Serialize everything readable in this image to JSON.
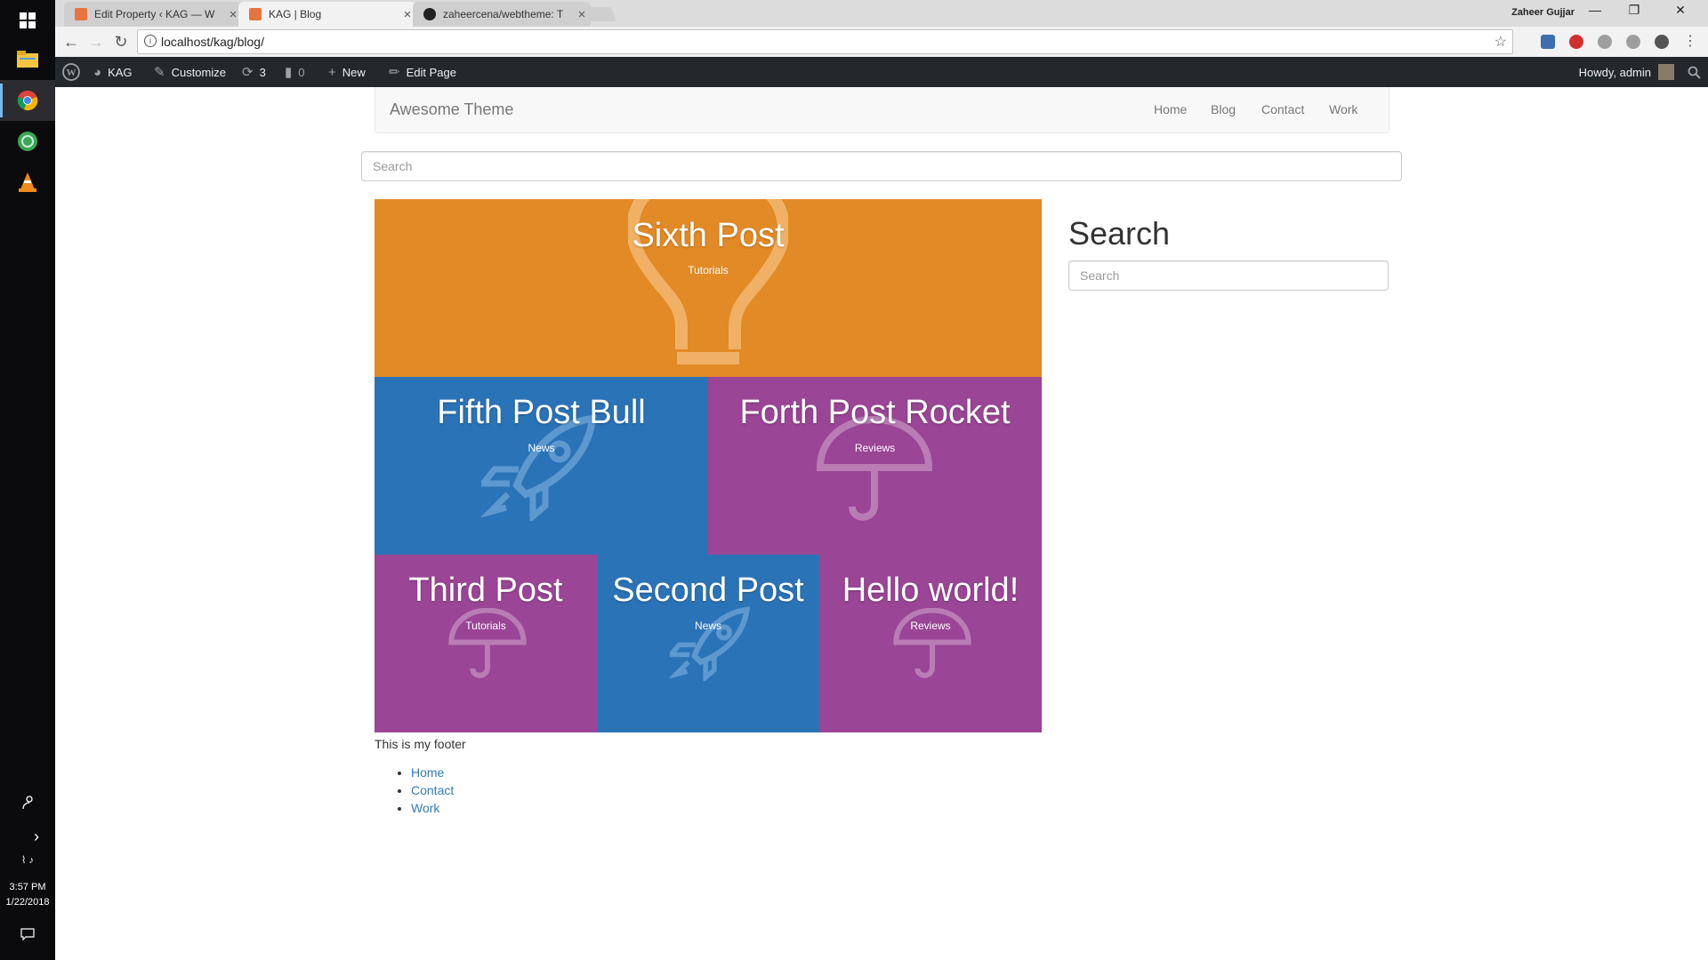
{
  "os": {
    "clock_time": "3:57 PM",
    "clock_date": "1/22/2018"
  },
  "browser": {
    "tabs": [
      {
        "label": "Edit Property ‹ KAG — W",
        "active": false
      },
      {
        "label": "KAG | Blog",
        "active": true
      },
      {
        "label": "zaheercena/webtheme: T",
        "active": false
      }
    ],
    "profile_name": "Zaheer Gujjar",
    "url": "localhost/kag/blog/"
  },
  "adminbar": {
    "site_name": "KAG",
    "customize": "Customize",
    "updates_count": "3",
    "comments_count": "0",
    "new": "New",
    "edit_page": "Edit Page",
    "howdy": "Howdy, admin"
  },
  "site": {
    "brand": "Awesome Theme",
    "nav": [
      "Home",
      "Blog",
      "Contact",
      "Work"
    ],
    "top_search_placeholder": "Search"
  },
  "posts": [
    {
      "title": "Sixth Post",
      "category": "Tutorials",
      "color": "#e28a26",
      "icon": "lightbulb-icon"
    },
    {
      "title": "Fifth Post Bull",
      "category": "News",
      "color": "#2b73b7",
      "icon": "rocket-icon"
    },
    {
      "title": "Forth Post Rocket",
      "category": "Reviews",
      "color": "#9a4595",
      "icon": "umbrella-icon"
    },
    {
      "title": "Third Post",
      "category": "Tutorials",
      "color": "#9a4595",
      "icon": "umbrella-icon"
    },
    {
      "title": "Second Post",
      "category": "News",
      "color": "#2b73b7",
      "icon": "rocket-icon"
    },
    {
      "title": "Hello world!",
      "category": "Reviews",
      "color": "#9a4595",
      "icon": "umbrella-icon"
    }
  ],
  "sidebar": {
    "title": "Search",
    "search_placeholder": "Search"
  },
  "footer": {
    "text": "This is my footer",
    "menu": [
      "Home",
      "Contact",
      "Work"
    ]
  }
}
